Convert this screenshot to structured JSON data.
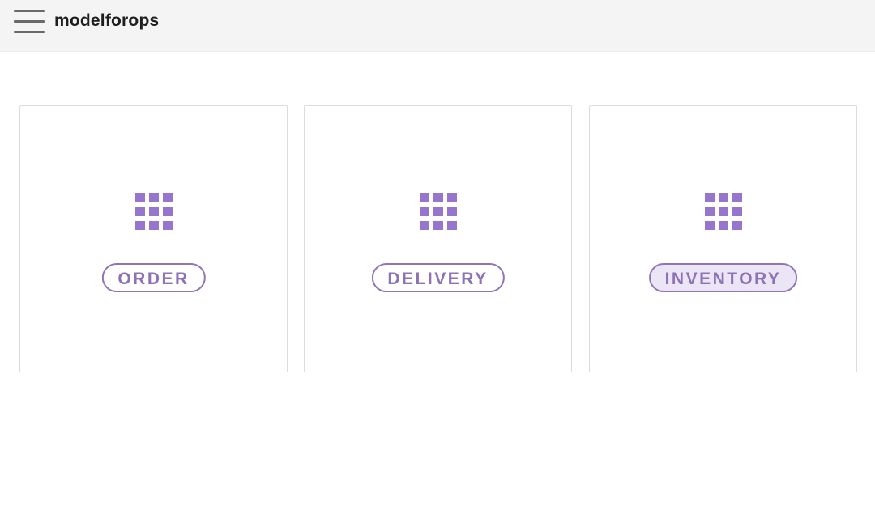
{
  "header": {
    "title": "modelforops",
    "menu_icon": "hamburger-menu-icon"
  },
  "cards": [
    {
      "label": "ORDER",
      "icon": "apps-grid-icon",
      "active": false
    },
    {
      "label": "DELIVERY",
      "icon": "apps-grid-icon",
      "active": false
    },
    {
      "label": "INVENTORY",
      "icon": "apps-grid-icon",
      "active": true
    }
  ],
  "colors": {
    "accent": "#9575cd",
    "active_fill": "#ebe5f6",
    "header_bg": "#f4f4f4"
  }
}
